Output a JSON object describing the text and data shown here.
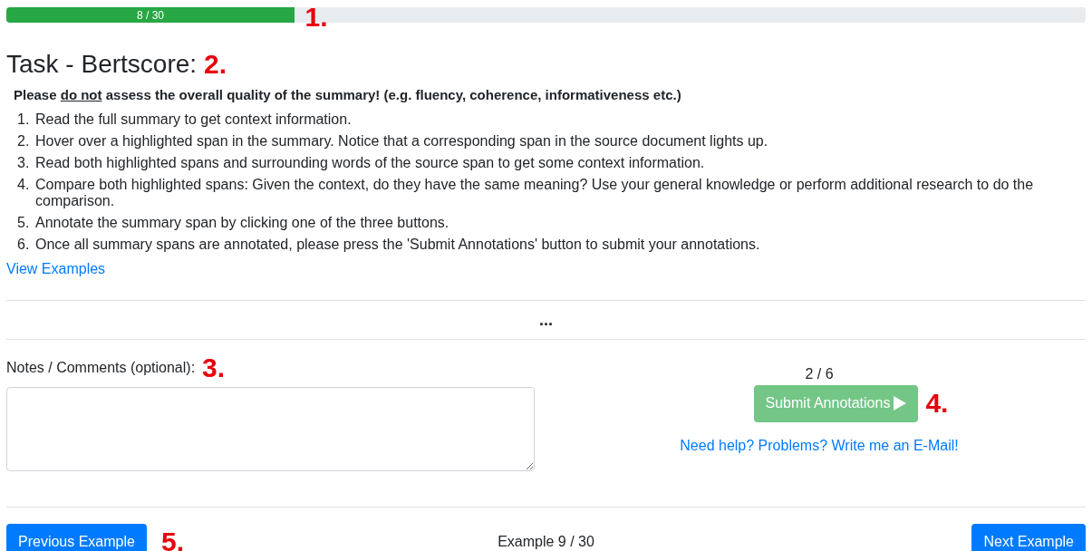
{
  "progress": {
    "label": "8 / 30",
    "level": 0.267,
    "marker": "1."
  },
  "task": {
    "title": "Task - Bertscore:",
    "marker": "2.",
    "notice": {
      "before": "Please ",
      "underlined": "do not",
      "after": " assess the overall quality of the summary! (e.g. fluency, coherence, informativeness etc.)"
    },
    "steps": [
      {
        "number": "1.",
        "text": "Read the full summary to get context information."
      },
      {
        "number": "2.",
        "text": "Hover over a highlighted span in the summary. Notice that a corresponding span in the source document lights up."
      },
      {
        "number": "3.",
        "text": "Read both highlighted spans and surrounding words of the source span to get some context information."
      },
      {
        "number": "4.",
        "text": "Compare both highlighted spans: Given the context, do they have the same meaning? Use your general knowledge or perform additional research to do the comparison."
      },
      {
        "number": "5.",
        "text": "Annotate the summary span by clicking one of the three buttons."
      },
      {
        "number": "6.",
        "text": "Once all summary spans are annotated, please press the 'Submit Annotations' button to submit your annotations."
      }
    ],
    "link": "View Examples"
  },
  "ellipsis": "...",
  "notes": {
    "label": "Notes / Comments (optional):",
    "marker": "3."
  },
  "submit": {
    "count": "2 / 6",
    "label": "Submit Annotations",
    "disabled": true,
    "marker": "4.",
    "help": "Need help? Problems? Write me an E-Mail!"
  },
  "footer": {
    "previous": "Previous Example",
    "marker": "5.",
    "position": "Example 9 / 30",
    "next": "Next Example"
  }
}
